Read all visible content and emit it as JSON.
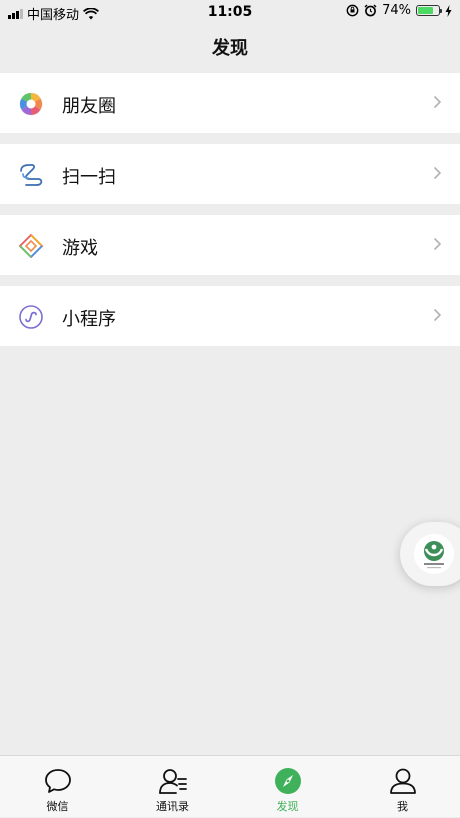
{
  "status_bar": {
    "carrier": "中国移动",
    "time": "11:05",
    "battery_percent": "74%",
    "battery_level": 0.74,
    "icons": [
      "signal-icon",
      "wifi-icon",
      "lock-rotation-icon",
      "alarm-icon",
      "battery-icon",
      "charging-icon"
    ]
  },
  "header": {
    "title": "发现"
  },
  "menu": {
    "items": [
      {
        "label": "朋友圈",
        "icon": "moments-icon"
      },
      {
        "label": "扫一扫",
        "icon": "scan-icon"
      },
      {
        "label": "游戏",
        "icon": "games-icon"
      },
      {
        "label": "小程序",
        "icon": "mini-programs-icon"
      }
    ]
  },
  "floating_ball": {
    "icon": "floating-app-logo-icon"
  },
  "tab_bar": {
    "tabs": [
      {
        "label": "微信",
        "icon": "chat-bubble-icon",
        "active": false
      },
      {
        "label": "通讯录",
        "icon": "contacts-icon",
        "active": false
      },
      {
        "label": "发现",
        "icon": "compass-icon",
        "active": true
      },
      {
        "label": "我",
        "icon": "person-icon",
        "active": false
      }
    ],
    "active_color": "#3fb15a"
  },
  "colors": {
    "background": "#ededed",
    "card": "#ffffff",
    "accent_green": "#3fb15a",
    "battery_green": "#4cd964"
  }
}
